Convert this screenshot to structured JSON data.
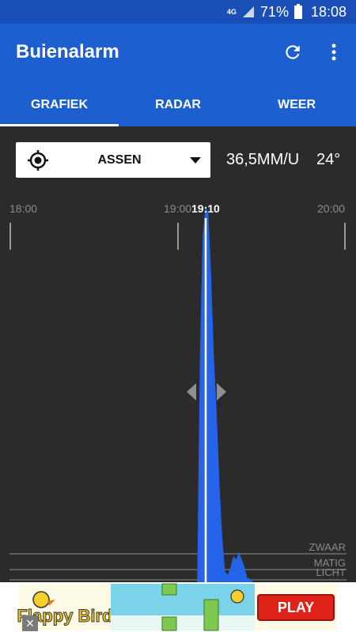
{
  "status_bar": {
    "network": "4G",
    "battery": "71%",
    "time": "18:08"
  },
  "app_bar": {
    "title": "Buienalarm"
  },
  "tabs": [
    {
      "label": "GRAFIEK",
      "active": true
    },
    {
      "label": "RADAR",
      "active": false
    },
    {
      "label": "WEER",
      "active": false
    }
  ],
  "location": {
    "value": "ASSEN"
  },
  "readouts": {
    "intensity": "36,5MM/U",
    "temperature": "24°"
  },
  "chart_data": {
    "type": "area",
    "x_ticks": [
      "18:00",
      "19:00",
      "19:10",
      "20:00"
    ],
    "current_time": "19:10",
    "intensity_labels": [
      "ZWAAR",
      "MATIG",
      "LICHT"
    ],
    "series": [
      {
        "x": [
          "19:07",
          "19:08",
          "19:09",
          "19:10",
          "19:11",
          "19:12",
          "19:13",
          "19:14",
          "19:15",
          "19:16",
          "19:17",
          "19:18",
          "19:19",
          "19:20",
          "19:21",
          "19:22",
          "19:23",
          "19:24",
          "19:25",
          "19:26",
          "19:27"
        ],
        "values": [
          0,
          0.6,
          0.92,
          1.0,
          0.98,
          0.82,
          0.6,
          0.45,
          0.26,
          0.12,
          0.03,
          0.02,
          0.04,
          0.07,
          0.06,
          0.08,
          0.06,
          0.04,
          0.01,
          0.01,
          0
        ]
      }
    ],
    "fill_color": "#2563e8"
  },
  "ad": {
    "game_title": "Flappy Bird",
    "button_label": "PLAY",
    "close": "×"
  }
}
